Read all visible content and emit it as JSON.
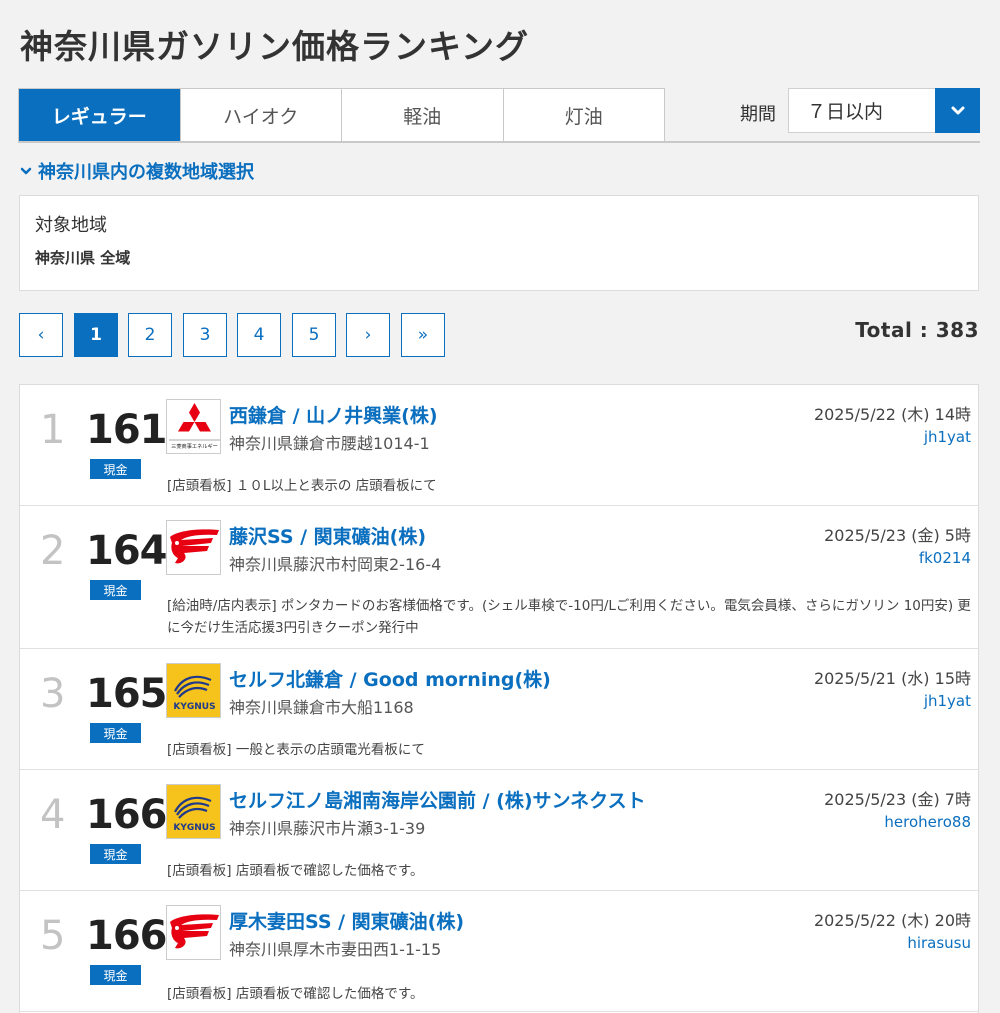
{
  "page": {
    "title": "神奈川県ガソリン価格ランキング"
  },
  "tabs": [
    "レギュラー",
    "ハイオク",
    "軽油",
    "灯油"
  ],
  "period": {
    "label": "期間",
    "value": "７日以内"
  },
  "region_toggle": "神奈川県内の複数地域選択",
  "region": {
    "label": "対象地域",
    "value": "神奈川県 全域"
  },
  "pagination": {
    "prev": "‹",
    "pages": [
      "1",
      "2",
      "3",
      "4",
      "5"
    ],
    "next": "›",
    "last": "»"
  },
  "total": "Total : 383",
  "colors": {
    "accent": "#0b6fbf",
    "background": "#f2f2f2"
  },
  "stations": [
    {
      "rank": "1",
      "price": "161",
      "payment": "現金",
      "logo": "mitsubishi-logo",
      "logo_text": "三菱商事エネルギー",
      "name": "西鎌倉 / 山ノ井興業(株)",
      "address": "神奈川県鎌倉市腰越1014-1",
      "date": "2025/5/22 (木) 14時",
      "user": "jh1yat",
      "note": "[店頭看板] １０L以上と表示の 店頭看板にて"
    },
    {
      "rank": "2",
      "price": "164",
      "payment": "現金",
      "logo": "idemitsu-logo",
      "logo_text": "",
      "name": "藤沢SS / 関東礦油(株)",
      "address": "神奈川県藤沢市村岡東2-16-4",
      "date": "2025/5/23 (金) 5時",
      "user": "fk0214",
      "note": "[給油時/店内表示] ポンタカードのお客様価格です。(シェル車検で-10円/Lご利用ください。電気会員様、さらにガソリン 10円安) 更に今だけ生活応援3円引きクーポン発行中"
    },
    {
      "rank": "3",
      "price": "165",
      "payment": "現金",
      "logo": "kygnus-logo",
      "logo_text": "KYGNUS",
      "name": "セルフ北鎌倉 / Good morning(株)",
      "address": "神奈川県鎌倉市大船1168",
      "date": "2025/5/21 (水) 15時",
      "user": "jh1yat",
      "note": "[店頭看板] 一般と表示の店頭電光看板にて"
    },
    {
      "rank": "4",
      "price": "166",
      "payment": "現金",
      "logo": "kygnus-logo",
      "logo_text": "KYGNUS",
      "name": "セルフ江ノ島湘南海岸公園前 / (株)サンネクスト",
      "address": "神奈川県藤沢市片瀬3-1-39",
      "date": "2025/5/23 (金) 7時",
      "user": "herohero88",
      "note": "[店頭看板] 店頭看板で確認した価格です。"
    },
    {
      "rank": "5",
      "price": "166",
      "payment": "現金",
      "logo": "idemitsu-logo",
      "logo_text": "",
      "name": "厚木妻田SS / 関東礦油(株)",
      "address": "神奈川県厚木市妻田西1-1-15",
      "date": "2025/5/22 (木) 20時",
      "user": "hirasusu",
      "note": "[店頭看板] 店頭看板で確認した価格です。"
    }
  ]
}
